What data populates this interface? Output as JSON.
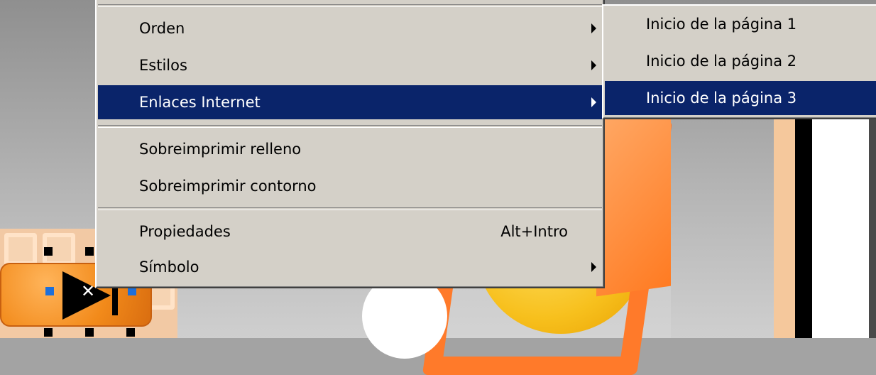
{
  "context_menu": {
    "items": [
      {
        "label": "Orden",
        "has_submenu": true
      },
      {
        "label": "Estilos",
        "has_submenu": true
      },
      {
        "label": "Enlaces Internet",
        "has_submenu": true,
        "highlighted": true
      },
      {
        "label": "Sobreimprimir relleno"
      },
      {
        "label": "Sobreimprimir contorno"
      },
      {
        "label": "Propiedades",
        "shortcut": "Alt+Intro"
      },
      {
        "label": "Símbolo",
        "has_submenu": true
      }
    ]
  },
  "submenu_enlaces": {
    "items": [
      {
        "label": "Inicio de la página 1"
      },
      {
        "label": "Inicio de la página 2"
      },
      {
        "label": "Inicio de la página 3",
        "highlighted": true
      }
    ]
  },
  "colors": {
    "menu_bg": "#d4d0c8",
    "highlight": "#0a246a",
    "accent_orange": "#ff7a2a",
    "accent_yellow": "#f7c01d"
  },
  "icons": {
    "submenu_arrow": "triangle-right-icon",
    "cross_marker": "x-icon"
  }
}
